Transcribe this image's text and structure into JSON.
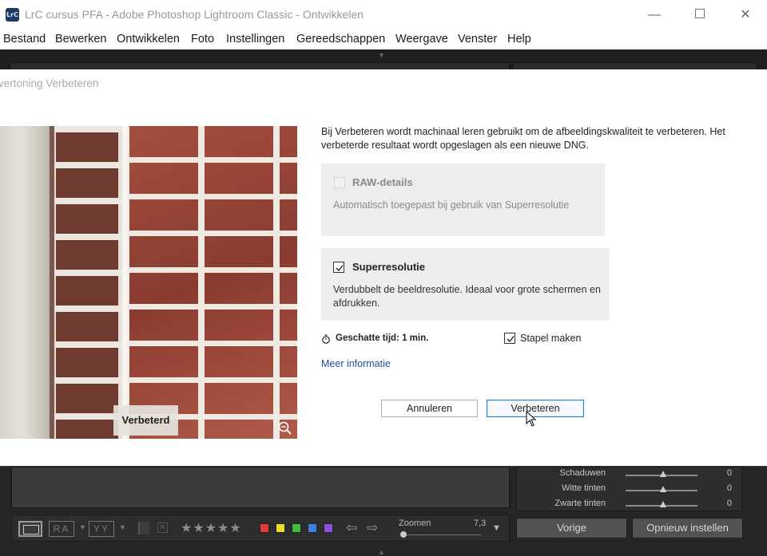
{
  "window": {
    "app_icon_text": "LrC",
    "title": "LrC cursus PFA - Adobe Photoshop Lightroom Classic - Ontwikkelen",
    "controls": {
      "minimize": "—",
      "close": "✕"
    }
  },
  "menu": {
    "items": [
      "Bestand",
      "Bewerken",
      "Ontwikkelen",
      "Foto",
      "Instellingen",
      "Gereedschappen",
      "Weergave",
      "Venster",
      "Help"
    ]
  },
  "dialog": {
    "title": "vertoning Verbeteren",
    "preview_label": "Verbeterd",
    "intro": "Bij Verbeteren wordt machinaal leren gebruikt om de afbeeldingskwaliteit te verbeteren. Het verbeterde resultaat wordt opgeslagen als een nieuwe DNG.",
    "raw_details": {
      "title": "RAW-details",
      "description": "Automatisch toegepast bij gebruik van Superresolutie",
      "checked": false,
      "enabled": false
    },
    "super_resolution": {
      "title": "Superresolutie",
      "description": "Verdubbelt de beeldresolutie. Ideaal voor grote schermen en afdrukken.",
      "checked": true,
      "enabled": true
    },
    "estimated_time": "Geschatte tijd: 1 min.",
    "stack": {
      "label": "Stapel maken",
      "checked": true
    },
    "more_info": "Meer informatie",
    "buttons": {
      "cancel": "Annuleren",
      "enhance": "Verbeteren"
    }
  },
  "develop_panel": {
    "sliders": [
      {
        "label": "Schaduwen",
        "value": "0"
      },
      {
        "label": "Witte tinten",
        "value": "0"
      },
      {
        "label": "Zwarte tinten",
        "value": "0"
      }
    ],
    "buttons": {
      "previous": "Vorige",
      "reset": "Opnieuw instellen"
    }
  },
  "toolbar": {
    "ra_label": "RA",
    "yy_label": "YY",
    "stars": "★★★★★",
    "color_labels": [
      "#e23b3b",
      "#e6e22a",
      "#3fbf3f",
      "#3f7fe0",
      "#8a4fe0"
    ],
    "zoom_label": "Zoomen",
    "zoom_value": "7,3"
  }
}
